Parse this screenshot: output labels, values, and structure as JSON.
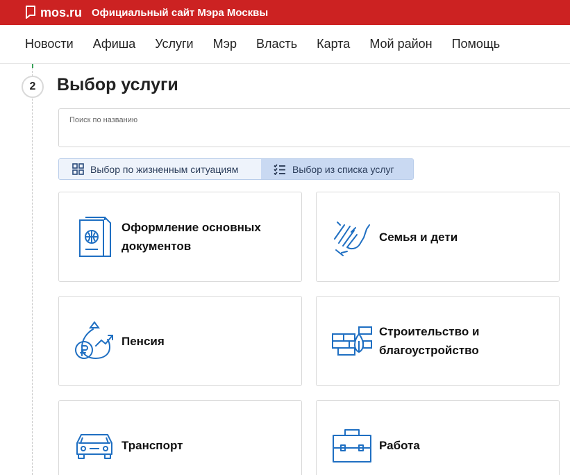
{
  "header": {
    "brand": "mos.ru",
    "site_title": "Официальный сайт Мэра Москвы",
    "brand_color": "#cc2222"
  },
  "nav": {
    "items": [
      "Новости",
      "Афиша",
      "Услуги",
      "Мэр",
      "Власть",
      "Карта",
      "Мой район",
      "Помощь"
    ]
  },
  "step": {
    "number": "2",
    "title": "Выбор услуги"
  },
  "search": {
    "label": "Поиск по названию",
    "value": "",
    "placeholder": ""
  },
  "tabs": [
    {
      "label": "Выбор по жизненным ситуациям",
      "icon": "grid-icon",
      "selected": false
    },
    {
      "label": "Выбор из списка услуг",
      "icon": "checklist-icon",
      "selected": true
    }
  ],
  "categories": [
    {
      "label": "Оформление основных документов",
      "icon": "passport-icon"
    },
    {
      "label": "Семья и дети",
      "icon": "hands-icon"
    },
    {
      "label": "Пенсия",
      "icon": "pension-bag-icon"
    },
    {
      "label": "Строительство и благоустройство",
      "icon": "bricks-leaf-icon"
    },
    {
      "label": "Транспорт",
      "icon": "car-icon"
    },
    {
      "label": "Работа",
      "icon": "briefcase-icon"
    }
  ],
  "colors": {
    "icon_blue": "#1f6fc2",
    "tab_active_bg": "#c9d9f2",
    "tab_inactive_bg": "#eef3fb"
  }
}
